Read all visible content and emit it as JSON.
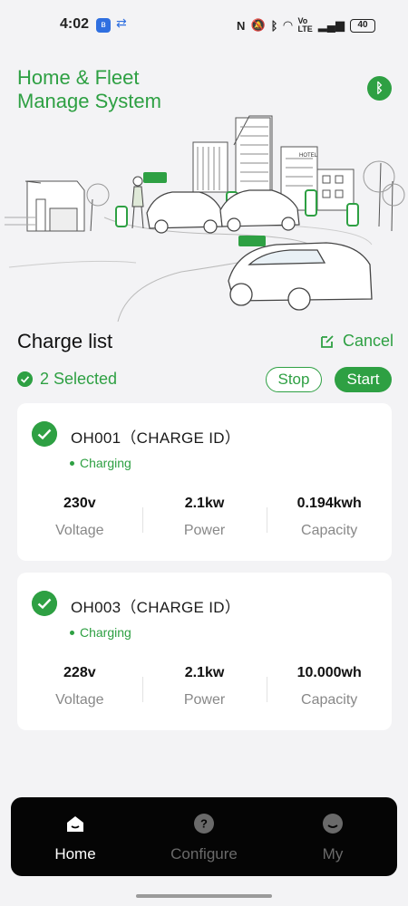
{
  "status_bar": {
    "time": "4:02",
    "battery": "40"
  },
  "header": {
    "title_line1": "Home & Fleet",
    "title_line2": "Manage System"
  },
  "colors": {
    "accent": "#2ea043",
    "background": "#f3f3f5",
    "nav_background": "#050505"
  },
  "charge_list": {
    "title": "Charge list",
    "cancel_label": "Cancel",
    "selected_label": "2 Selected",
    "stop_label": "Stop",
    "start_label": "Start",
    "items": [
      {
        "id": "OH001（CHARGE ID）",
        "status": "Charging",
        "metrics": [
          {
            "value": "230v",
            "label": "Voltage"
          },
          {
            "value": "2.1kw",
            "label": "Power"
          },
          {
            "value": "0.194kwh",
            "label": "Capacity"
          }
        ]
      },
      {
        "id": "OH003（CHARGE ID）",
        "status": "Charging",
        "metrics": [
          {
            "value": "228v",
            "label": "Voltage"
          },
          {
            "value": "2.1kw",
            "label": "Power"
          },
          {
            "value": "10.000wh",
            "label": "Capacity"
          }
        ]
      }
    ]
  },
  "nav": {
    "items": [
      {
        "label": "Home",
        "icon": "home-icon",
        "active": true
      },
      {
        "label": "Configure",
        "icon": "help-icon",
        "active": false
      },
      {
        "label": "My",
        "icon": "user-icon",
        "active": false
      }
    ]
  },
  "hero_signs": {
    "hotel": "HOTEL"
  }
}
